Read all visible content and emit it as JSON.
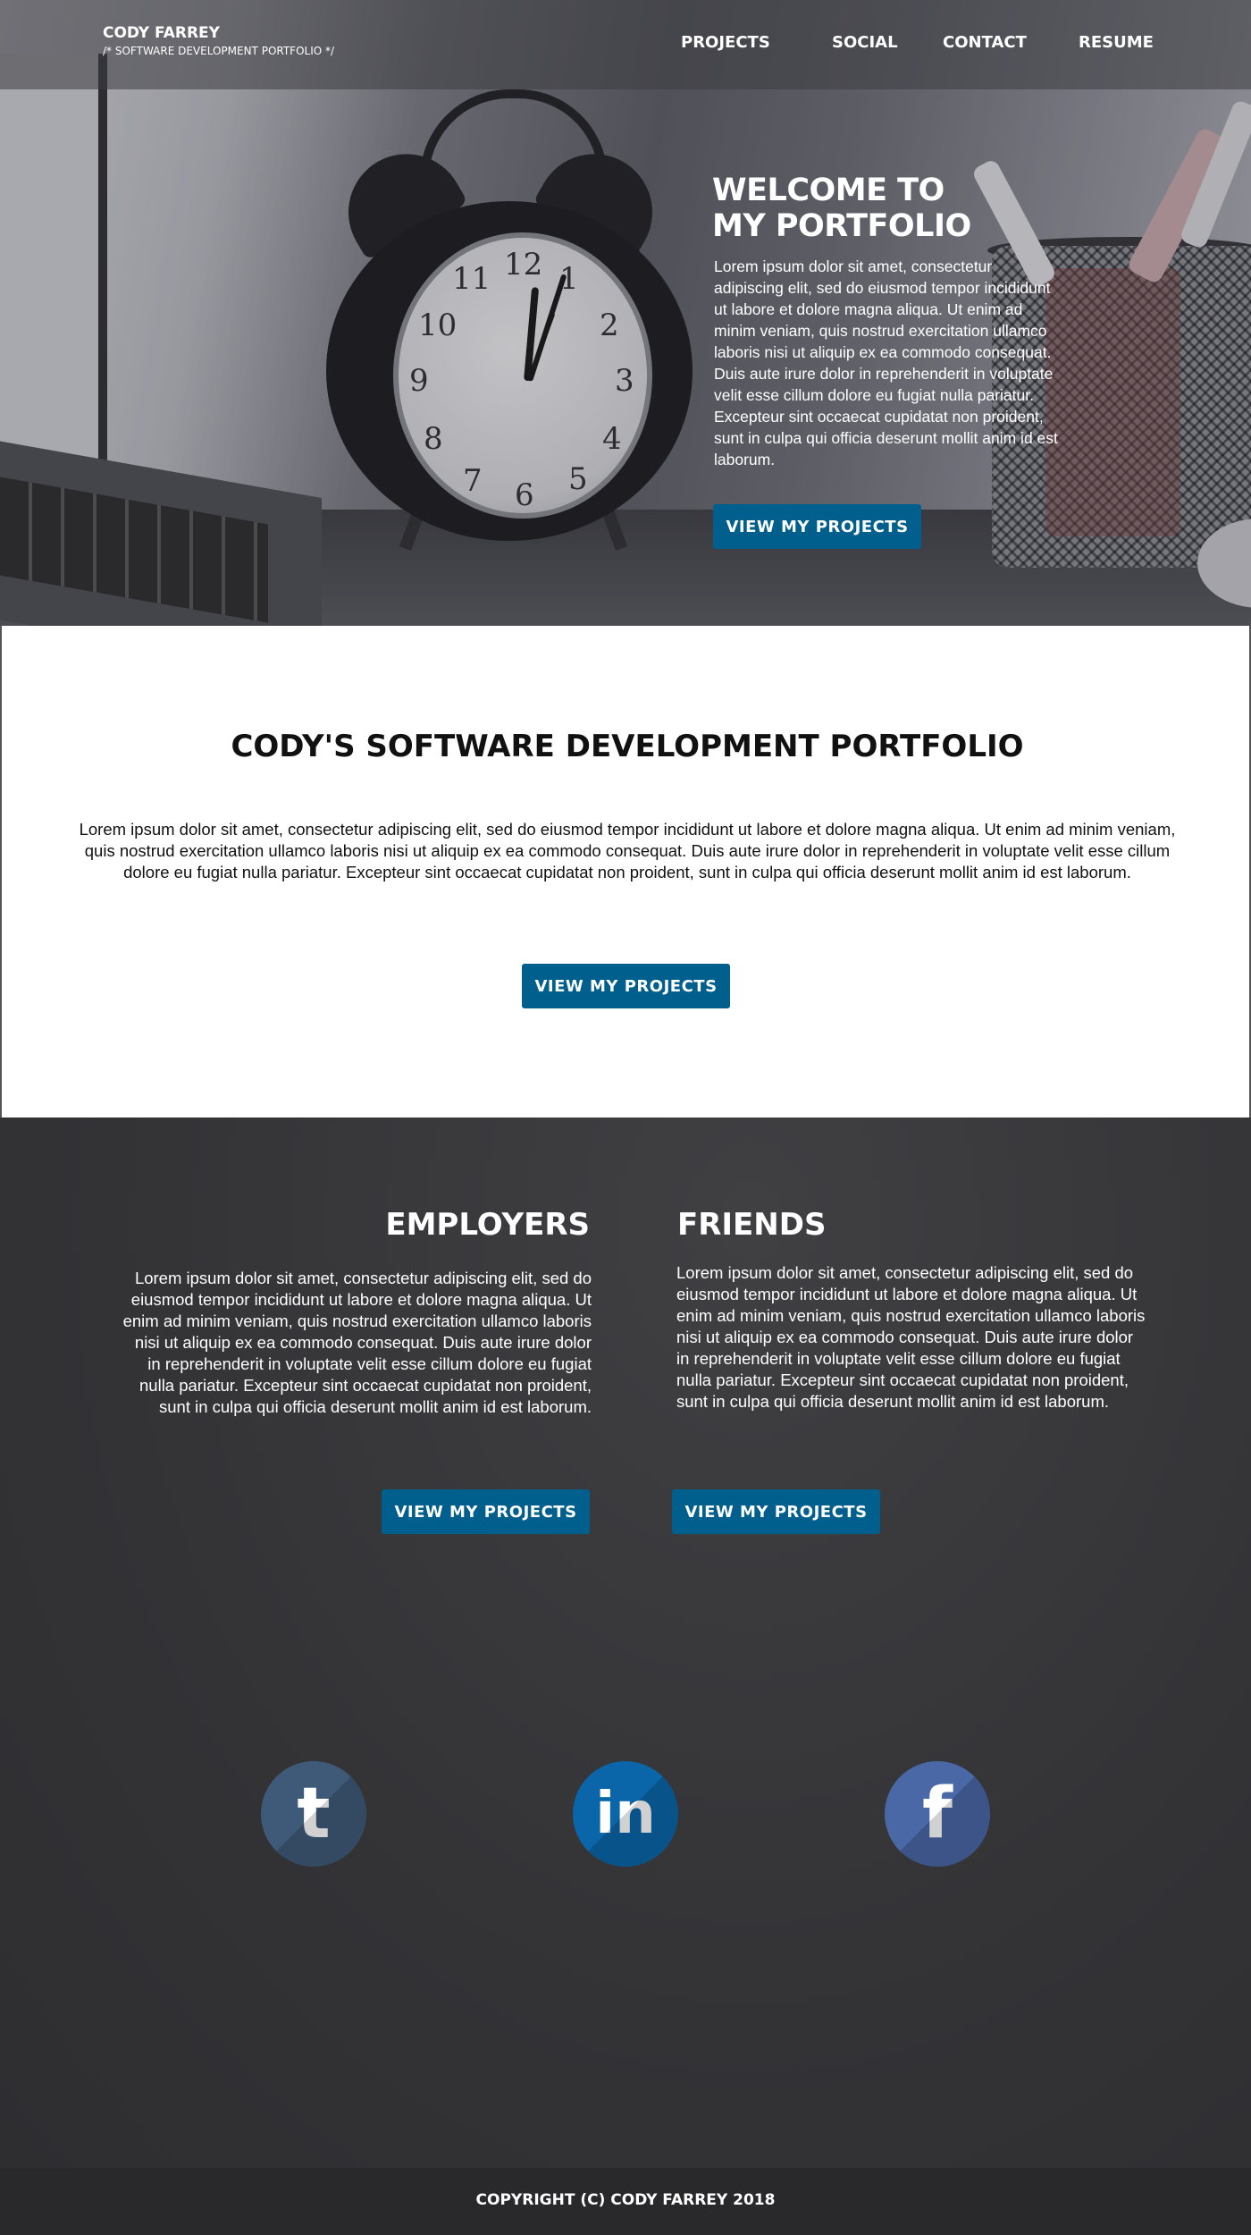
{
  "header": {
    "brand_name": "CODY FARREY",
    "brand_tagline": "/* SOFTWARE DEVELOPMENT PORTFOLIO */",
    "nav": [
      "PROJECTS",
      "SOCIAL",
      "CONTACT",
      "RESUME"
    ]
  },
  "hero": {
    "title_line1": "WELCOME TO",
    "title_line2": "MY PORTFOLIO",
    "body": "Lorem ipsum dolor sit amet, consectetur adipiscing elit, sed do eiusmod tempor incididunt ut labore et dolore magna aliqua. Ut enim ad minim veniam, quis nostrud exercitation ullamco laboris nisi ut aliquip ex ea commodo consequat. Duis aute irure dolor in reprehenderit in voluptate velit esse cillum dolore eu fugiat nulla pariatur. Excepteur sint occaecat cupidatat non proident, sunt in culpa qui officia deserunt mollit anim id est laborum.",
    "button": "VIEW MY PROJECTS"
  },
  "intro": {
    "title": "CODY'S SOFTWARE DEVELOPMENT PORTFOLIO",
    "body": "Lorem ipsum dolor sit amet, consectetur adipiscing elit, sed do eiusmod tempor incididunt ut labore et dolore magna aliqua. Ut enim ad minim veniam, quis nostrud exercitation ullamco laboris nisi ut aliquip ex ea commodo consequat. Duis aute irure dolor in reprehenderit in voluptate velit esse cillum dolore eu fugiat nulla pariatur. Excepteur sint occaecat cupidatat non proident, sunt in culpa qui officia deserunt mollit anim id est laborum.",
    "button": "VIEW MY PROJECTS"
  },
  "audiences": {
    "employers": {
      "title": "EMPLOYERS",
      "body": "Lorem ipsum dolor sit amet, consectetur adipiscing elit, sed do eiusmod tempor incididunt ut labore et dolore magna aliqua. Ut enim ad minim veniam, quis nostrud exercitation ullamco laboris nisi ut aliquip ex ea commodo consequat. Duis aute irure dolor in reprehenderit in voluptate velit esse cillum dolore eu fugiat nulla pariatur. Excepteur sint occaecat cupidatat non proident, sunt in culpa qui officia deserunt mollit anim id est laborum.",
      "button": "VIEW MY PROJECTS"
    },
    "friends": {
      "title": "FRIENDS",
      "body": "Lorem ipsum dolor sit amet, consectetur adipiscing elit, sed do eiusmod tempor incididunt ut labore et dolore magna aliqua. Ut enim ad minim veniam, quis nostrud exercitation ullamco laboris nisi ut aliquip ex ea commodo consequat. Duis aute irure dolor in reprehenderit in voluptate velit esse cillum dolore eu fugiat nulla pariatur. Excepteur sint occaecat cupidatat non proident, sunt in culpa qui officia deserunt mollit anim id est laborum.",
      "button": "VIEW MY PROJECTS"
    }
  },
  "social": [
    {
      "icon": "tumblr-icon",
      "glyph": "t",
      "color": "#3e5a78"
    },
    {
      "icon": "linkedin-icon",
      "glyph": "in",
      "color": "#0a66a8"
    },
    {
      "icon": "facebook-icon",
      "glyph": "f",
      "color": "#4a67a6"
    }
  ],
  "colors": {
    "accent_button": "#005f8c",
    "dark_section": "#333336",
    "footer": "#29292b"
  },
  "footer": {
    "copyright": "COPYRIGHT (C) CODY FARREY 2018"
  }
}
